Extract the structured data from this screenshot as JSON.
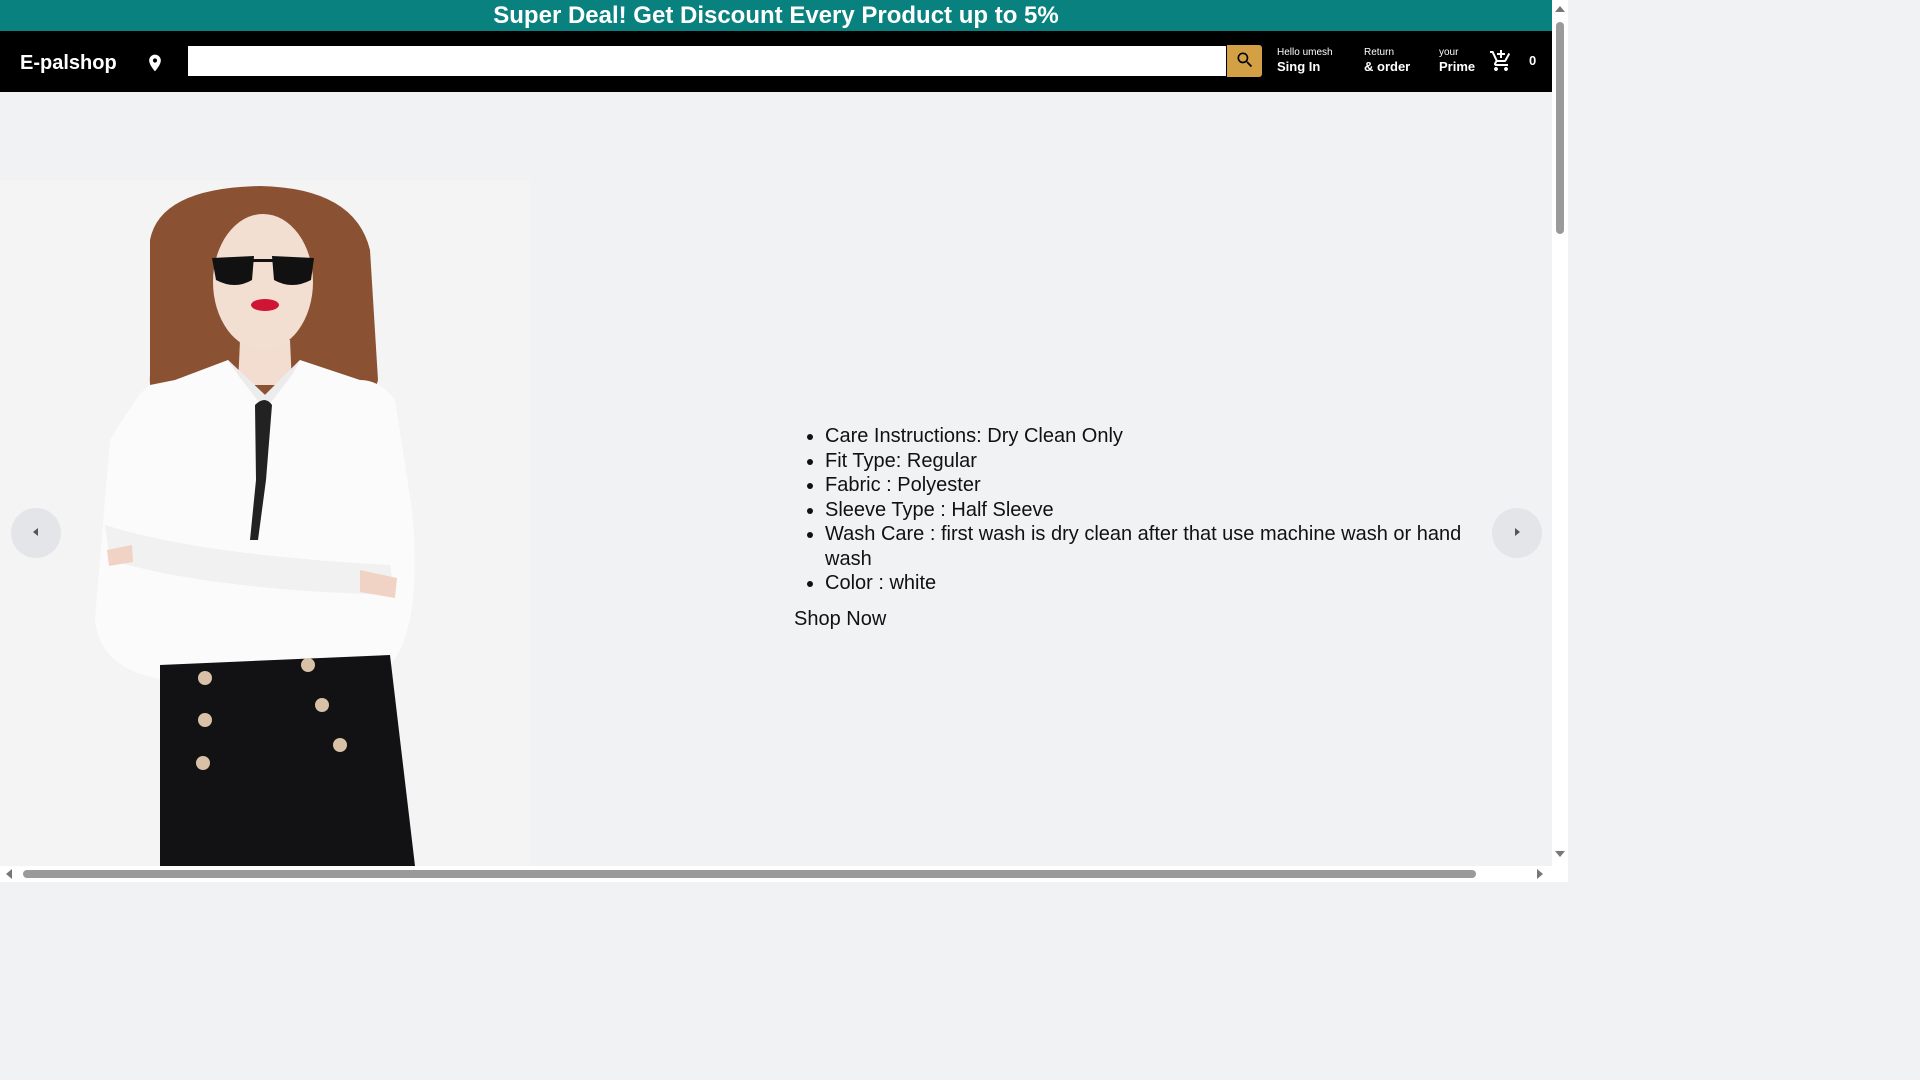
{
  "promo": {
    "text": "Super Deal! Get Discount Every Product up to 5%"
  },
  "header": {
    "logo": "E-palshop",
    "search": {
      "value": "",
      "placeholder": ""
    },
    "account": {
      "line1": "Hello umesh",
      "line2": "Sing In"
    },
    "returns": {
      "line1": "Return",
      "line2": "& order"
    },
    "prime": {
      "line1": "your",
      "line2": "Prime"
    },
    "cart_count": "0"
  },
  "product": {
    "details": [
      "Care Instructions: Dry Clean Only",
      "Fit Type: Regular",
      "Fabric : Polyester",
      "Sleeve Type : Half Sleeve",
      "Wash Care : first wash is dry clean after that use machine wash or hand wash",
      "Color : white"
    ],
    "cta": "Shop Now"
  },
  "colors": {
    "promo_bar": "#08817f",
    "navbar": "#000000",
    "search_button": "#d3a046",
    "page_background": "#f1f2f4"
  },
  "icons": {
    "location": "location-pin-icon",
    "search": "search-icon",
    "cart": "add-shopping-cart-icon",
    "carousel_prev": "chevron-left-icon",
    "carousel_next": "chevron-right-icon"
  }
}
